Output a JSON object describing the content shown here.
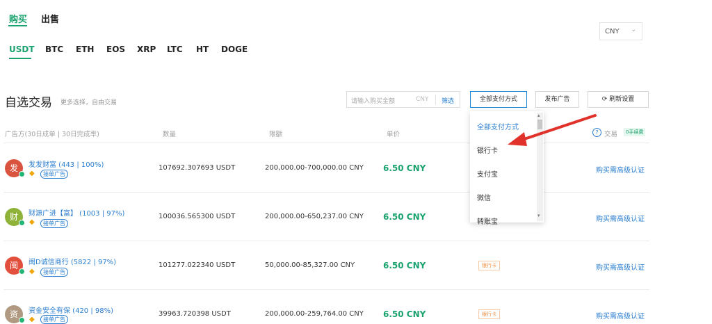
{
  "top_tabs": {
    "buy": "购买",
    "sell": "出售"
  },
  "coins": [
    "USDT",
    "BTC",
    "ETH",
    "EOS",
    "XRP",
    "LTC",
    "HT",
    "DOGE"
  ],
  "currency_select": {
    "value": "CNY"
  },
  "section": {
    "title": "自选交易",
    "subtitle": "更多选择，自由交易"
  },
  "search": {
    "placeholder": "请输入购买金额",
    "currency": "CNY",
    "button": "筛选"
  },
  "toolbar": {
    "payment_filter": "全部支付方式",
    "post_ad": "发布广告",
    "refresh": "刷新设置"
  },
  "table": {
    "headers": {
      "advertiser": "广告方(30日成单 | 30日完成率)",
      "quantity": "数量",
      "limits": "限额",
      "price": "单价",
      "trade": "交易",
      "badge": "0手续费"
    },
    "rows": [
      {
        "avatar_char": "发",
        "avatar_color": "#d9533f",
        "name": "发发财富 (443 | 100%)",
        "tag": "接单广告",
        "quantity": "107692.307693 USDT",
        "limits": "200,000.00-700,000.00 CNY",
        "price": "6.50 CNY",
        "payment": "",
        "requirement": "购买需高级认证"
      },
      {
        "avatar_char": "财",
        "avatar_color": "#8fb339",
        "name": "财源广进【富】 (1003 | 97%)",
        "tag": "接单广告",
        "quantity": "100036.565300 USDT",
        "limits": "200,000.00-650,237.00 CNY",
        "price": "6.50 CNY",
        "payment": "",
        "requirement": "购买需高级认证"
      },
      {
        "avatar_char": "闽",
        "avatar_color": "#e2503d",
        "name": "闽D诚信商行 (5822 | 97%)",
        "tag": "接单广告",
        "quantity": "101277.022340 USDT",
        "limits": "50,000.00-85,327.00 CNY",
        "price": "6.50 CNY",
        "payment": "银行卡",
        "requirement": "购买需高级认证"
      },
      {
        "avatar_char": "资",
        "avatar_color": "#b09a82",
        "name": "资金安全有保 (420 | 98%)",
        "tag": "接单广告",
        "quantity": "39963.720398 USDT",
        "limits": "200,000.00-259,764.00 CNY",
        "price": "6.50 CNY",
        "payment": "银行卡",
        "requirement": "购买需高级认证"
      }
    ]
  },
  "dropdown": {
    "items": [
      "全部支付方式",
      "银行卡",
      "支付宝",
      "微信",
      "转账宝"
    ]
  },
  "colors": {
    "accent": "#1aa36e",
    "link": "#2b7fd0",
    "annotation": "#e0322b"
  }
}
